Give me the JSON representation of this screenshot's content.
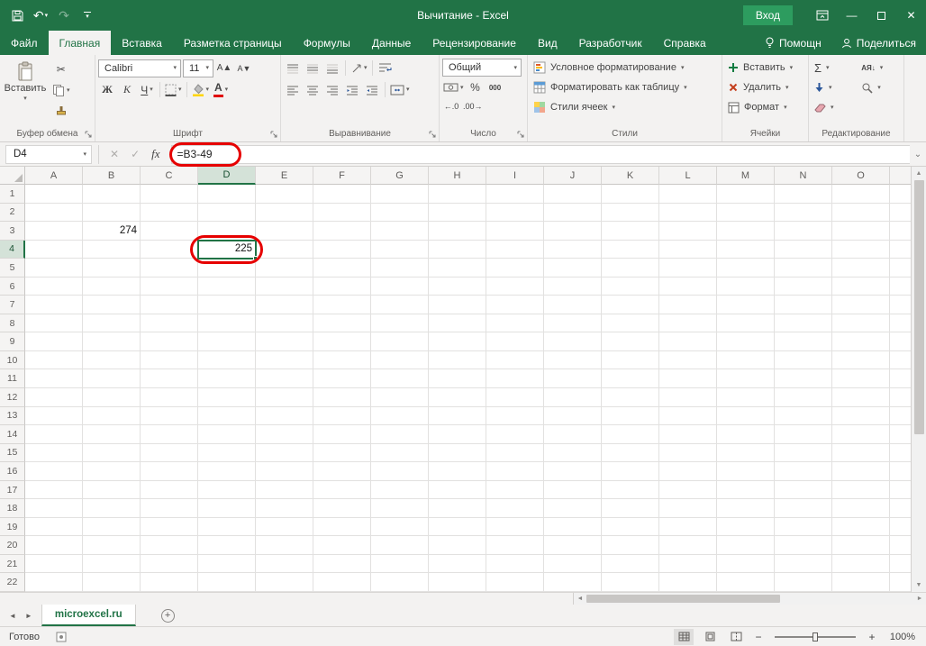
{
  "window": {
    "title": "Вычитание - Excel",
    "sign_in": "Вход"
  },
  "icons": {
    "caret": "▾",
    "scissors": "✂",
    "undo": "↶",
    "redo": "↷",
    "minimize": "—",
    "close": "✕",
    "cancel": "✕",
    "check": "✓",
    "fx": "fx",
    "expand_formula_bar": "⌄",
    "sigma": "Σ",
    "percent": "%",
    "thousands": "000",
    "inc_decimal": "←.0",
    "dec_decimal": ".00→",
    "grow_font": "А▲",
    "shrink_font": "А▼",
    "sort_az": "АЯ↓",
    "left": "◄",
    "right": "►",
    "up": "▲",
    "down": "▼",
    "plus": "+",
    "minus": "−",
    "add_sheet": "+"
  },
  "ribbon_tabs": [
    {
      "label": "Файл"
    },
    {
      "label": "Главная",
      "active": true
    },
    {
      "label": "Вставка"
    },
    {
      "label": "Разметка страницы"
    },
    {
      "label": "Формулы"
    },
    {
      "label": "Данные"
    },
    {
      "label": "Рецензирование"
    },
    {
      "label": "Вид"
    },
    {
      "label": "Разработчик"
    },
    {
      "label": "Справка"
    }
  ],
  "tab_extras": {
    "helper": "Помощн",
    "share": "Поделиться"
  },
  "ribbon": {
    "clipboard": {
      "paste": "Вставить",
      "group": "Буфер обмена"
    },
    "font": {
      "name": "Calibri",
      "size": "11",
      "bold": "Ж",
      "italic": "К",
      "underline": "Ч",
      "color_letter": "А",
      "group": "Шрифт"
    },
    "alignment": {
      "group": "Выравнивание"
    },
    "number": {
      "format": "Общий",
      "group": "Число"
    },
    "styles": {
      "conditional": "Условное форматирование",
      "format_table": "Форматировать как таблицу",
      "cell_styles": "Стили ячеек",
      "group": "Стили"
    },
    "cells": {
      "insert": "Вставить",
      "delete": "Удалить",
      "format": "Формат",
      "group": "Ячейки"
    },
    "editing": {
      "group": "Редактирование"
    }
  },
  "formula_bar": {
    "name_box": "D4",
    "formula": "=B3-49"
  },
  "grid": {
    "columns": [
      "A",
      "B",
      "C",
      "D",
      "E",
      "F",
      "G",
      "H",
      "I",
      "J",
      "K",
      "L",
      "M",
      "N",
      "O"
    ],
    "row_count": 22,
    "selected_column": "D",
    "selected_row": 4,
    "selected_cell": "D4",
    "cells": [
      {
        "col": "B",
        "row": 3,
        "value": "274"
      },
      {
        "col": "D",
        "row": 4,
        "value": "225",
        "selected": true,
        "annotated": true
      }
    ]
  },
  "sheet_bar": {
    "active_tab": "microexcel.ru"
  },
  "status_bar": {
    "status": "Готово",
    "zoom": "100%"
  }
}
